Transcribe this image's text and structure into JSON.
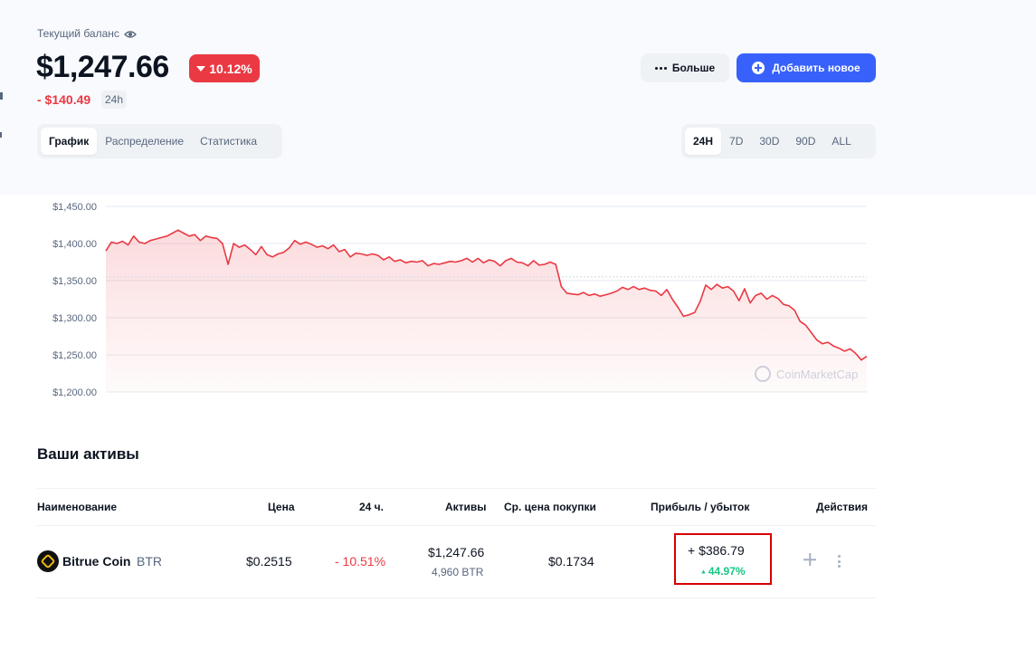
{
  "header": {
    "balance_label": "Текущий баланс",
    "balance_value": "$1,247.66",
    "change_percent": "10.12%",
    "change_abs": "- $140.49",
    "period": "24h"
  },
  "actions": {
    "more_label": "Больше",
    "add_label": "Добавить новое"
  },
  "view_tabs": [
    "График",
    "Распределение",
    "Статистика"
  ],
  "active_view": "График",
  "range_tabs": [
    "24H",
    "7D",
    "30D",
    "90D",
    "ALL"
  ],
  "active_range": "24H",
  "colors": {
    "accent": "#3861fb",
    "negative": "#ea3943",
    "positive": "#16c784",
    "highlight": "#d60000"
  },
  "chart_data": {
    "type": "area",
    "series": [
      {
        "values": [
          1390,
          1402,
          1400,
          1403,
          1398,
          1410,
          1402,
          1400,
          1404,
          1406,
          1408,
          1410,
          1414,
          1418,
          1414,
          1410,
          1412,
          1404,
          1410,
          1408,
          1407,
          1400,
          1372,
          1400,
          1395,
          1398,
          1392,
          1385,
          1396,
          1385,
          1382,
          1386,
          1388,
          1394,
          1404,
          1399,
          1402,
          1399,
          1395,
          1397,
          1393,
          1398,
          1389,
          1392,
          1382,
          1387,
          1386,
          1384,
          1386,
          1384,
          1378,
          1382,
          1376,
          1378,
          1374,
          1376,
          1375,
          1377,
          1370,
          1373,
          1372,
          1374,
          1376,
          1375,
          1377,
          1380,
          1375,
          1380,
          1374,
          1378,
          1376,
          1370,
          1377,
          1380,
          1375,
          1374,
          1370,
          1377,
          1371,
          1372,
          1375,
          1372,
          1342,
          1333,
          1332,
          1331,
          1334,
          1330,
          1332,
          1329,
          1331,
          1333,
          1336,
          1341,
          1338,
          1342,
          1338,
          1340,
          1337,
          1336,
          1330,
          1338,
          1325,
          1314,
          1302,
          1304,
          1307,
          1322,
          1344,
          1338,
          1345,
          1340,
          1342,
          1336,
          1323,
          1339,
          1320,
          1330,
          1333,
          1325,
          1330,
          1326,
          1318,
          1316,
          1310,
          1295,
          1290,
          1280,
          1270,
          1265,
          1267,
          1262,
          1259,
          1255,
          1258,
          1252,
          1243,
          1248
        ]
      }
    ],
    "yticks": [
      "$1,450.00",
      "$1,400.00",
      "$1,350.00",
      "$1,300.00",
      "$1,250.00",
      "$1,200.00"
    ],
    "ylim": [
      1200,
      1450
    ],
    "reference_line": 1355,
    "grid": true,
    "watermark": "CoinMarketCap"
  },
  "assets": {
    "title": "Ваши активы",
    "columns": [
      "Наименование",
      "Цена",
      "24 ч.",
      "Активы",
      "Ср. цена покупки",
      "Прибыль / убыток",
      "Действия"
    ],
    "rows": [
      {
        "name": "Bitrue Coin",
        "symbol": "BTR",
        "price": "$0.2515",
        "change_24h": "- 10.51%",
        "holdings_value": "$1,247.66",
        "holdings_amount": "4,960 BTR",
        "avg_buy_price": "$0.1734",
        "pnl_value": "+ $386.79",
        "pnl_percent": "44.97%"
      }
    ]
  }
}
